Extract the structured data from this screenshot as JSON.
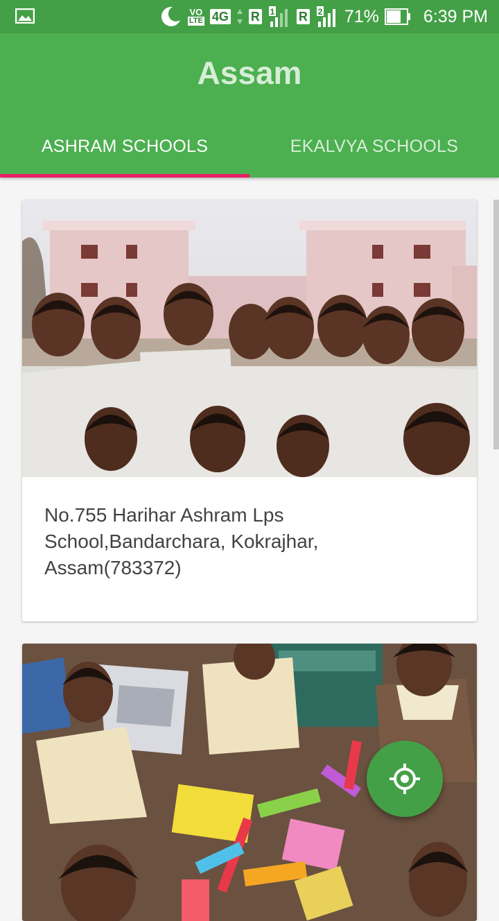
{
  "status_bar": {
    "network": "4G",
    "volte": "VO",
    "lte": "LTE",
    "sim1": "R",
    "sim1_slot": "1",
    "sim2": "R",
    "sim2_slot": "2",
    "battery": "71%",
    "time": "6:39 PM"
  },
  "app_bar": {
    "title": "Assam"
  },
  "tabs": [
    {
      "label": "ASHRAM SCHOOLS",
      "selected": true
    },
    {
      "label": "EKALVYA SCHOOLS",
      "selected": false
    }
  ],
  "cards": [
    {
      "image": "school-children-photo",
      "text": "No.755 Harihar Ashram Lps School,Bandarchara, Kokrajhar, Assam(783372)"
    },
    {
      "image": "children-crafts-photo",
      "text": ""
    }
  ],
  "fab": {
    "icon": "my-location-icon"
  },
  "colors": {
    "primary": "#4caf50",
    "accent": "#e91e63",
    "fab": "#43a047"
  }
}
